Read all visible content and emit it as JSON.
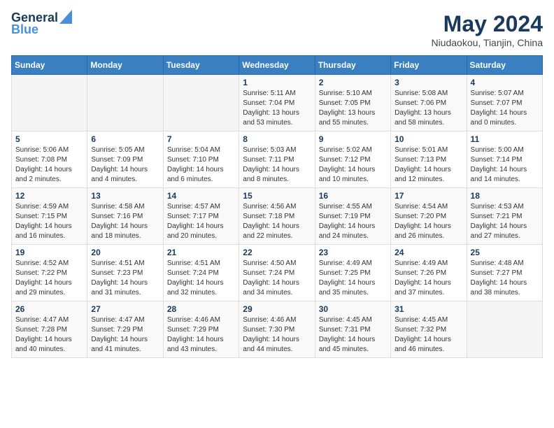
{
  "header": {
    "logo_line1": "General",
    "logo_line2": "Blue",
    "title": "May 2024",
    "subtitle": "Niudaokou, Tianjin, China"
  },
  "weekdays": [
    "Sunday",
    "Monday",
    "Tuesday",
    "Wednesday",
    "Thursday",
    "Friday",
    "Saturday"
  ],
  "weeks": [
    [
      {
        "day": "",
        "info": ""
      },
      {
        "day": "",
        "info": ""
      },
      {
        "day": "",
        "info": ""
      },
      {
        "day": "1",
        "info": "Sunrise: 5:11 AM\nSunset: 7:04 PM\nDaylight: 13 hours\nand 53 minutes."
      },
      {
        "day": "2",
        "info": "Sunrise: 5:10 AM\nSunset: 7:05 PM\nDaylight: 13 hours\nand 55 minutes."
      },
      {
        "day": "3",
        "info": "Sunrise: 5:08 AM\nSunset: 7:06 PM\nDaylight: 13 hours\nand 58 minutes."
      },
      {
        "day": "4",
        "info": "Sunrise: 5:07 AM\nSunset: 7:07 PM\nDaylight: 14 hours\nand 0 minutes."
      }
    ],
    [
      {
        "day": "5",
        "info": "Sunrise: 5:06 AM\nSunset: 7:08 PM\nDaylight: 14 hours\nand 2 minutes."
      },
      {
        "day": "6",
        "info": "Sunrise: 5:05 AM\nSunset: 7:09 PM\nDaylight: 14 hours\nand 4 minutes."
      },
      {
        "day": "7",
        "info": "Sunrise: 5:04 AM\nSunset: 7:10 PM\nDaylight: 14 hours\nand 6 minutes."
      },
      {
        "day": "8",
        "info": "Sunrise: 5:03 AM\nSunset: 7:11 PM\nDaylight: 14 hours\nand 8 minutes."
      },
      {
        "day": "9",
        "info": "Sunrise: 5:02 AM\nSunset: 7:12 PM\nDaylight: 14 hours\nand 10 minutes."
      },
      {
        "day": "10",
        "info": "Sunrise: 5:01 AM\nSunset: 7:13 PM\nDaylight: 14 hours\nand 12 minutes."
      },
      {
        "day": "11",
        "info": "Sunrise: 5:00 AM\nSunset: 7:14 PM\nDaylight: 14 hours\nand 14 minutes."
      }
    ],
    [
      {
        "day": "12",
        "info": "Sunrise: 4:59 AM\nSunset: 7:15 PM\nDaylight: 14 hours\nand 16 minutes."
      },
      {
        "day": "13",
        "info": "Sunrise: 4:58 AM\nSunset: 7:16 PM\nDaylight: 14 hours\nand 18 minutes."
      },
      {
        "day": "14",
        "info": "Sunrise: 4:57 AM\nSunset: 7:17 PM\nDaylight: 14 hours\nand 20 minutes."
      },
      {
        "day": "15",
        "info": "Sunrise: 4:56 AM\nSunset: 7:18 PM\nDaylight: 14 hours\nand 22 minutes."
      },
      {
        "day": "16",
        "info": "Sunrise: 4:55 AM\nSunset: 7:19 PM\nDaylight: 14 hours\nand 24 minutes."
      },
      {
        "day": "17",
        "info": "Sunrise: 4:54 AM\nSunset: 7:20 PM\nDaylight: 14 hours\nand 26 minutes."
      },
      {
        "day": "18",
        "info": "Sunrise: 4:53 AM\nSunset: 7:21 PM\nDaylight: 14 hours\nand 27 minutes."
      }
    ],
    [
      {
        "day": "19",
        "info": "Sunrise: 4:52 AM\nSunset: 7:22 PM\nDaylight: 14 hours\nand 29 minutes."
      },
      {
        "day": "20",
        "info": "Sunrise: 4:51 AM\nSunset: 7:23 PM\nDaylight: 14 hours\nand 31 minutes."
      },
      {
        "day": "21",
        "info": "Sunrise: 4:51 AM\nSunset: 7:24 PM\nDaylight: 14 hours\nand 32 minutes."
      },
      {
        "day": "22",
        "info": "Sunrise: 4:50 AM\nSunset: 7:24 PM\nDaylight: 14 hours\nand 34 minutes."
      },
      {
        "day": "23",
        "info": "Sunrise: 4:49 AM\nSunset: 7:25 PM\nDaylight: 14 hours\nand 35 minutes."
      },
      {
        "day": "24",
        "info": "Sunrise: 4:49 AM\nSunset: 7:26 PM\nDaylight: 14 hours\nand 37 minutes."
      },
      {
        "day": "25",
        "info": "Sunrise: 4:48 AM\nSunset: 7:27 PM\nDaylight: 14 hours\nand 38 minutes."
      }
    ],
    [
      {
        "day": "26",
        "info": "Sunrise: 4:47 AM\nSunset: 7:28 PM\nDaylight: 14 hours\nand 40 minutes."
      },
      {
        "day": "27",
        "info": "Sunrise: 4:47 AM\nSunset: 7:29 PM\nDaylight: 14 hours\nand 41 minutes."
      },
      {
        "day": "28",
        "info": "Sunrise: 4:46 AM\nSunset: 7:29 PM\nDaylight: 14 hours\nand 43 minutes."
      },
      {
        "day": "29",
        "info": "Sunrise: 4:46 AM\nSunset: 7:30 PM\nDaylight: 14 hours\nand 44 minutes."
      },
      {
        "day": "30",
        "info": "Sunrise: 4:45 AM\nSunset: 7:31 PM\nDaylight: 14 hours\nand 45 minutes."
      },
      {
        "day": "31",
        "info": "Sunrise: 4:45 AM\nSunset: 7:32 PM\nDaylight: 14 hours\nand 46 minutes."
      },
      {
        "day": "",
        "info": ""
      }
    ]
  ]
}
